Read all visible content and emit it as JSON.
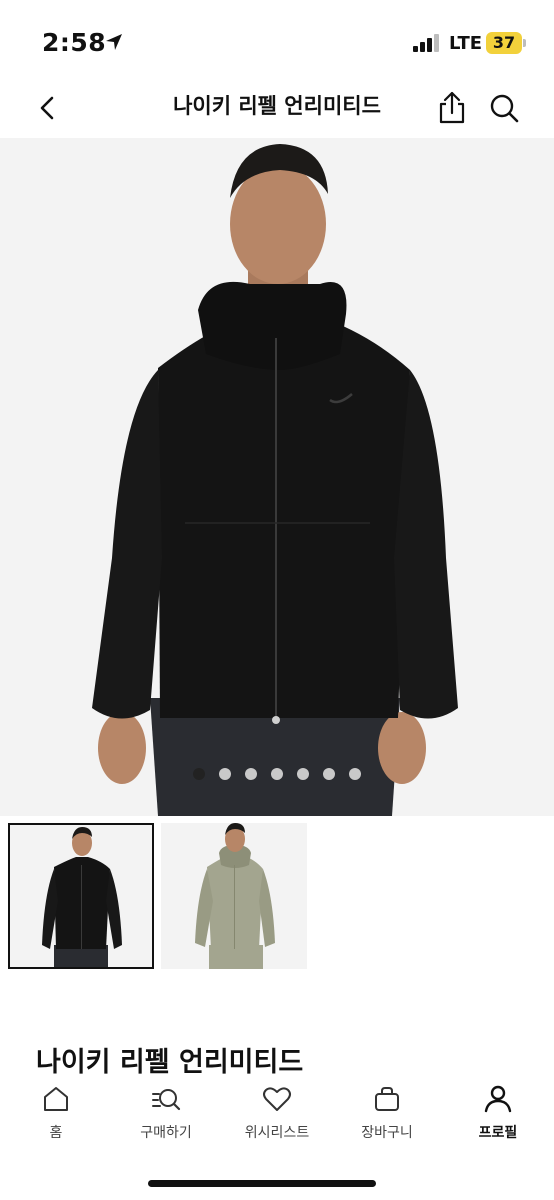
{
  "status_bar": {
    "time": "2:58",
    "network": "LTE",
    "battery": "37",
    "icons": [
      "location-arrow-icon",
      "signal-bars-icon",
      "battery-icon"
    ]
  },
  "header": {
    "title": "나이키 리펠 언리미티드",
    "icons": [
      "chevron-left-icon",
      "share-icon",
      "search-icon"
    ]
  },
  "gallery": {
    "image_count": 7,
    "active_index": 0,
    "colors": {
      "background": "#f3f3f3",
      "jacket_black": "#141414",
      "jacket_olive": "#a3a58f",
      "skin": "#b78667"
    },
    "thumbnails": [
      {
        "color": "black",
        "selected": true
      },
      {
        "color": "olive",
        "selected": false
      }
    ]
  },
  "product": {
    "name": "나이키 리펠 언리미티드"
  },
  "tab_bar": {
    "items": [
      {
        "label": "홈",
        "icon": "home-icon",
        "active": false
      },
      {
        "label": "구매하기",
        "icon": "browse-search-icon",
        "active": false
      },
      {
        "label": "위시리스트",
        "icon": "heart-icon",
        "active": false
      },
      {
        "label": "장바구니",
        "icon": "bag-icon",
        "active": false
      },
      {
        "label": "프로필",
        "icon": "profile-icon",
        "active": true
      }
    ]
  }
}
